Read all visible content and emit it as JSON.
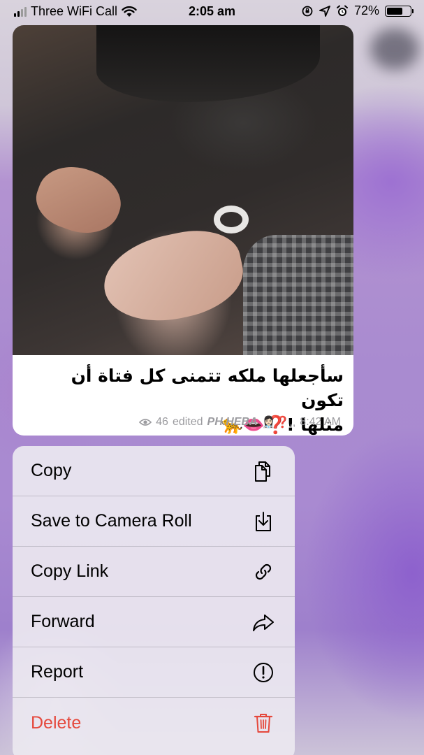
{
  "status_bar": {
    "carrier": "Three WiFi Call",
    "time": "2:05 am",
    "battery": "72%",
    "battery_level": 0.72
  },
  "message": {
    "caption_line1": "سأجعلها ملكه تتمنى كل فتاة أن تكون",
    "caption_line2": "مثلها !❓👄🐆",
    "views": "46",
    "edited_label": "edited",
    "author": "PH.HEBA",
    "author_suffix": "👩🏻‍⚕️❓.,",
    "time": "8:42 AM"
  },
  "context_menu": {
    "items": [
      {
        "label": "Copy",
        "icon": "copy-icon"
      },
      {
        "label": "Save to Camera Roll",
        "icon": "save-download-icon"
      },
      {
        "label": "Copy Link",
        "icon": "link-icon"
      },
      {
        "label": "Forward",
        "icon": "forward-arrow-icon"
      },
      {
        "label": "Report",
        "icon": "exclamation-circle-icon"
      },
      {
        "label": "Delete",
        "icon": "trash-icon"
      }
    ],
    "destructive_color": "#e5483c"
  }
}
